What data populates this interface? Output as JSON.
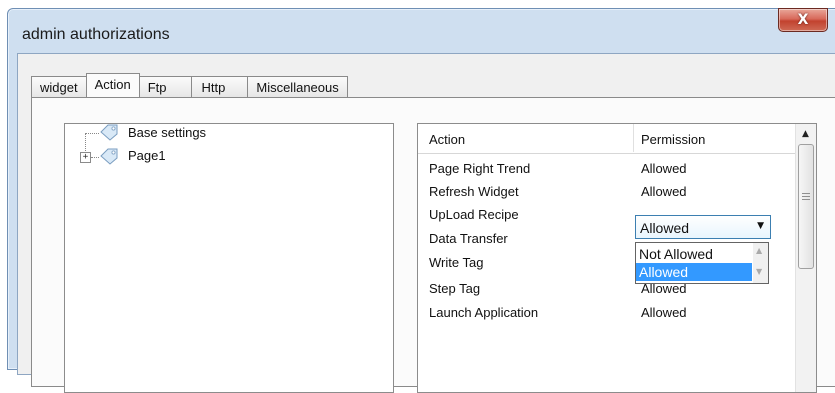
{
  "window": {
    "title": "admin authorizations",
    "close_glyph": "X"
  },
  "tabs": [
    {
      "label": "widget",
      "active": false
    },
    {
      "label": "Action",
      "active": true
    },
    {
      "label": "Ftp",
      "active": false
    },
    {
      "label": "Http",
      "active": false
    },
    {
      "label": "Miscellaneous",
      "active": false
    }
  ],
  "tree": {
    "items": [
      {
        "label": "Base settings",
        "icon": "tag-icon",
        "expandable": false
      },
      {
        "label": "Page1",
        "icon": "tag-icon",
        "expandable": true,
        "expander_glyph": "+"
      }
    ]
  },
  "grid": {
    "columns": [
      "Action",
      "Permission"
    ],
    "rows": [
      {
        "action": "Page Right Trend",
        "permission": "Allowed"
      },
      {
        "action": "Refresh Widget",
        "permission": "Allowed"
      },
      {
        "action": "UpLoad Recipe",
        "permission": "Allowed"
      },
      {
        "action": "Data Transfer",
        "permission": ""
      },
      {
        "action": "Write Tag",
        "permission": ""
      },
      {
        "action": "Step Tag",
        "permission": "Allowed"
      },
      {
        "action": "Launch Application",
        "permission": "Allowed"
      }
    ],
    "scroll_up_glyph": "▲"
  },
  "dropdown": {
    "value": "Allowed",
    "arrow_glyph": "▼",
    "options": [
      {
        "label": "Not Allowed",
        "selected": false
      },
      {
        "label": "Allowed",
        "selected": true
      }
    ],
    "list_up_glyph": "▲",
    "list_down_glyph": "▼"
  },
  "colors": {
    "selection": "#3399ff",
    "combo_border": "#3c7fb1",
    "close_button": "#c2422f"
  }
}
